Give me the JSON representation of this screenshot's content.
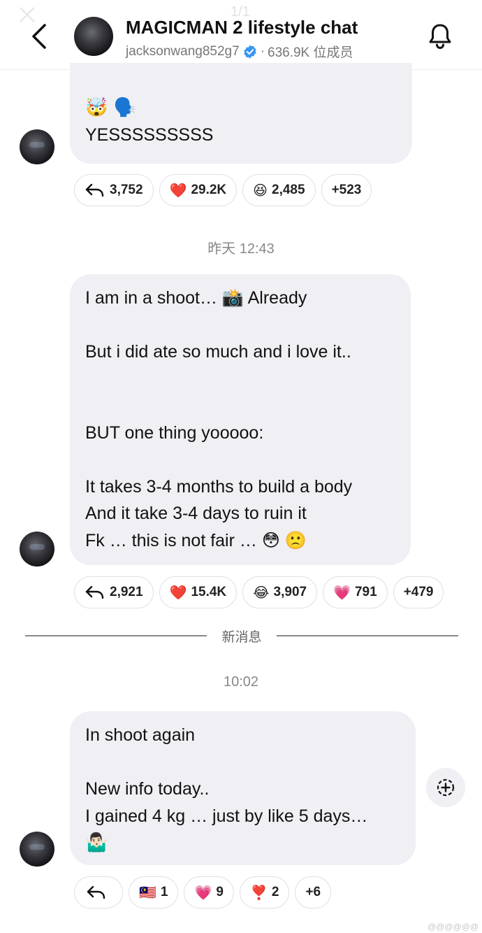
{
  "overlay": {
    "page_indicator": "1/1"
  },
  "header": {
    "title": "MAGICMAN 2 lifestyle chat",
    "handle": "jacksonwang852g7",
    "separator": "·",
    "members": "636.9K 位成员"
  },
  "messages": [
    {
      "lines": [
        "🤯 🗣️",
        "YESSSSSSSSS"
      ],
      "reactions": [
        {
          "icon": "reply-icon",
          "count": "3,752"
        },
        {
          "emoji": "❤️",
          "icon": "heart-emoji",
          "count": "29.2K"
        },
        {
          "emoji": "😆",
          "icon": "laughing-emoji",
          "count": "2,485"
        },
        {
          "count": "+523"
        }
      ]
    },
    {
      "timestamp": "昨天 12:43",
      "lines": [
        "I am in a shoot… 📸 Already",
        "",
        "But i did ate so much and i love it..",
        "",
        "",
        "BUT one thing yooooo:",
        "",
        "It takes 3-4 months to build a body",
        "And it take 3-4 days to ruin it",
        "Fk … this is not fair … 😳 🙁"
      ],
      "reactions": [
        {
          "icon": "reply-icon",
          "count": "2,921"
        },
        {
          "emoji": "❤️",
          "icon": "heart-emoji",
          "count": "15.4K"
        },
        {
          "emoji": "😂",
          "icon": "tears-of-joy-emoji",
          "count": "3,907"
        },
        {
          "emoji": "💗",
          "icon": "growing-heart-emoji",
          "count": "791"
        },
        {
          "count": "+479"
        }
      ]
    },
    {
      "divider_label": "新消息",
      "timestamp": "10:02",
      "lines": [
        "In shoot again",
        "",
        "New info today..",
        "I gained 4 kg … just by like 5 days…",
        "🤷🏻‍♂️"
      ],
      "reactions": [
        {
          "icon": "reply-icon",
          "count": ""
        },
        {
          "emoji": "🇲🇾",
          "icon": "malaysia-flag-emoji",
          "count": "1"
        },
        {
          "emoji": "💗",
          "icon": "growing-heart-emoji",
          "count": "9"
        },
        {
          "emoji": "❣️",
          "icon": "heart-exclamation-emoji",
          "count": "2"
        },
        {
          "count": "+6"
        }
      ]
    }
  ],
  "watermark": "@@@@@@"
}
